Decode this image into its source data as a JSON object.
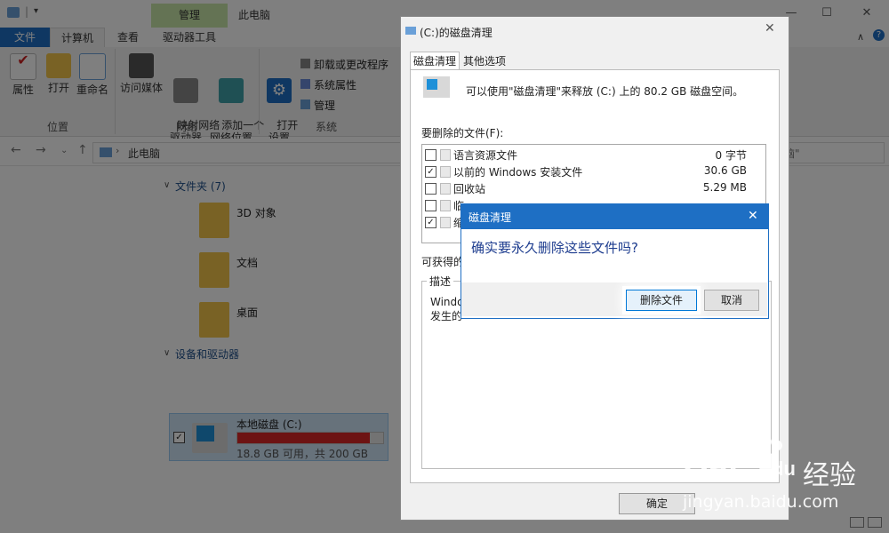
{
  "explorer": {
    "title": "此电脑",
    "context_tab": "管理",
    "tabs": [
      "文件",
      "计算机",
      "查看",
      "驱动器工具"
    ],
    "ribbon": {
      "location": {
        "label": "位置",
        "buttons": [
          "属性",
          "打开",
          "重命名"
        ]
      },
      "network": {
        "label": "网络",
        "buttons": [
          "访问媒体",
          "映射网络\n驱动器",
          "添加一个\n网络位置"
        ]
      },
      "system": {
        "label": "系统",
        "open_settings": "打开\n设置",
        "links": [
          "卸载或更改程序",
          "系统属性",
          "管理"
        ]
      }
    },
    "address": "此电脑",
    "search_placeholder": "脑\"",
    "folders_header": "文件夹 (7)",
    "folders": [
      "3D 对象",
      "文档",
      "桌面"
    ],
    "devices_header": "设备和驱动器",
    "drive": {
      "name": "本地磁盘 (C:)",
      "info": "18.8 GB 可用，共 200 GB",
      "used_fraction": 0.906
    }
  },
  "cleanup": {
    "title": "(C:)的磁盘清理",
    "tabs": [
      "磁盘清理",
      "其他选项"
    ],
    "description": "可以使用\"磁盘清理\"来释放 (C:) 上的 80.2 GB 磁盘空间。",
    "files_label": "要删除的文件(F):",
    "files": [
      {
        "name": "语言资源文件",
        "size": "0 字节",
        "checked": false
      },
      {
        "name": "以前的 Windows 安装文件",
        "size": "30.6 GB",
        "checked": true
      },
      {
        "name": "回收站",
        "size": "5.29 MB",
        "checked": false
      },
      {
        "name": "临",
        "size": "",
        "checked": false
      },
      {
        "name": "缩",
        "size": "",
        "checked": true
      }
    ],
    "gain_label": "可获得的",
    "desc_group": "描述",
    "desc_text_1": "Windo",
    "desc_text_2": "发生的",
    "ok": "确定"
  },
  "confirm": {
    "title": "磁盘清理",
    "message": "确实要永久删除这些文件吗?",
    "delete_button": "删除文件",
    "cancel_button": "取消"
  },
  "watermark": {
    "brand": "Bai",
    "brand2": "du",
    "suffix": "经验",
    "url": "jingyan.baidu.com"
  },
  "colors": {
    "accent": "#1e6fc4",
    "manage_tab": "#c8e6a8",
    "drive_bar": "#da2626"
  }
}
